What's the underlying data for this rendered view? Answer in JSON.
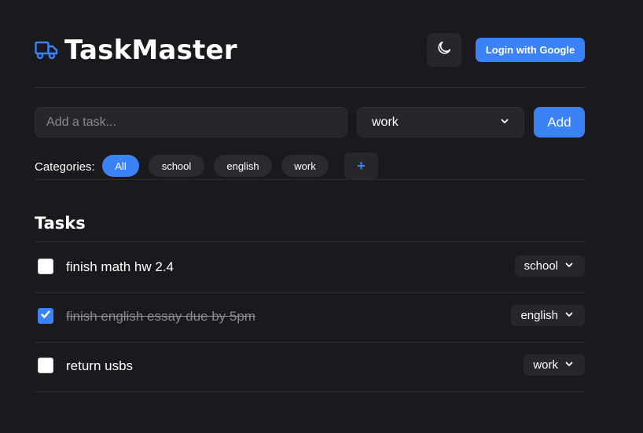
{
  "app": {
    "title": "TaskMaster",
    "brand_icon": "truck-icon",
    "accent_color": "#3b82f6"
  },
  "header": {
    "theme_toggle_icon": "moon-icon",
    "login_label": "Login with Google"
  },
  "new_task": {
    "placeholder": "Add a task...",
    "value": "",
    "category_selected": "work",
    "add_label": "Add"
  },
  "categories": {
    "label": "Categories:",
    "items": [
      "All",
      "school",
      "english",
      "work"
    ],
    "active": "All",
    "add_label": "+"
  },
  "tasks": {
    "heading": "Tasks",
    "items": [
      {
        "text": "finish math hw 2.4",
        "done": false,
        "category": "school"
      },
      {
        "text": "finish english essay due by 5pm",
        "done": true,
        "category": "english"
      },
      {
        "text": "return usbs",
        "done": false,
        "category": "work"
      }
    ]
  }
}
